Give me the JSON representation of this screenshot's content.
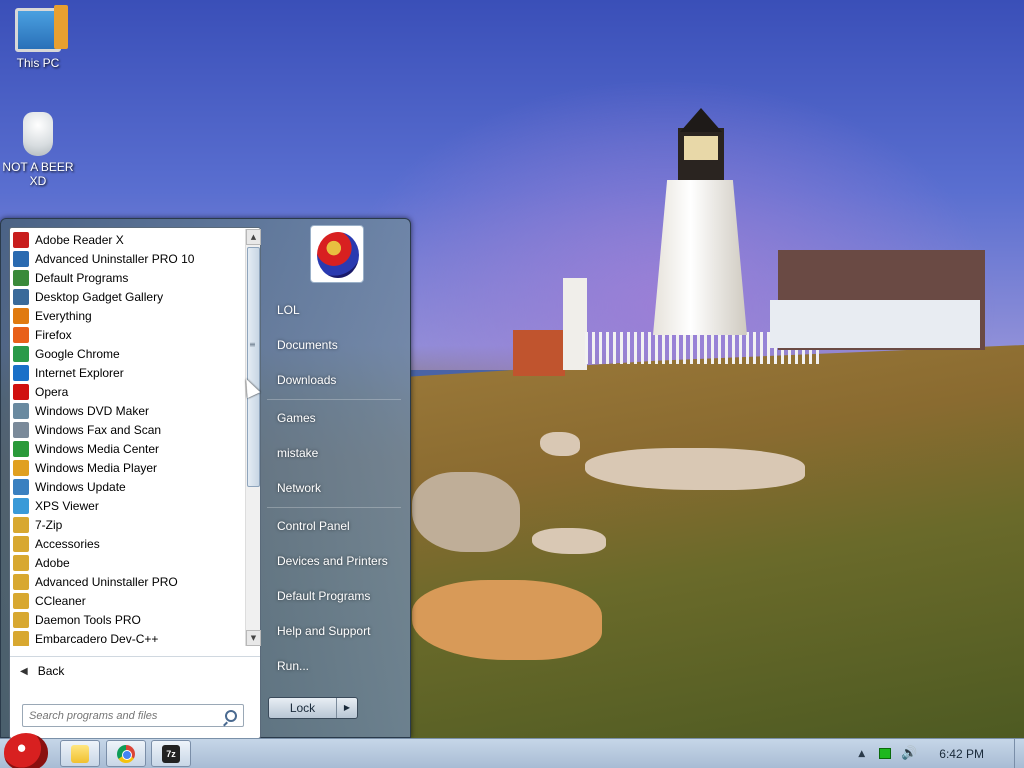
{
  "desktop": {
    "icons": [
      {
        "label": "This PC",
        "icon": "computer-icon"
      },
      {
        "label": "NOT A BEER XD",
        "icon": "jar-icon"
      }
    ]
  },
  "start_menu": {
    "programs": [
      {
        "label": "Adobe Reader X",
        "icon": "adobe-reader-icon",
        "color": "#c81e1e"
      },
      {
        "label": "Advanced Uninstaller PRO 10",
        "icon": "uninstaller-icon",
        "color": "#2a6ab0"
      },
      {
        "label": "Default Programs",
        "icon": "default-programs-icon",
        "color": "#3a8a3a"
      },
      {
        "label": "Desktop Gadget Gallery",
        "icon": "gadget-icon",
        "color": "#3a6a9a"
      },
      {
        "label": "Everything",
        "icon": "everything-icon",
        "color": "#e07a10"
      },
      {
        "label": "Firefox",
        "icon": "firefox-icon",
        "color": "#e8601a"
      },
      {
        "label": "Google Chrome",
        "icon": "chrome-icon",
        "color": "#2a9a4a"
      },
      {
        "label": "Internet Explorer",
        "icon": "ie-icon",
        "color": "#1a70c8"
      },
      {
        "label": "Opera",
        "icon": "opera-icon",
        "color": "#d01010"
      },
      {
        "label": "Windows DVD Maker",
        "icon": "dvd-maker-icon",
        "color": "#6a8aa0"
      },
      {
        "label": "Windows Fax and Scan",
        "icon": "fax-icon",
        "color": "#7a8a9a"
      },
      {
        "label": "Windows Media Center",
        "icon": "media-center-icon",
        "color": "#2a9a3a"
      },
      {
        "label": "Windows Media Player",
        "icon": "media-player-icon",
        "color": "#e0a020"
      },
      {
        "label": "Windows Update",
        "icon": "windows-update-icon",
        "color": "#3a80c0"
      },
      {
        "label": "XPS Viewer",
        "icon": "xps-viewer-icon",
        "color": "#3a9ad8"
      },
      {
        "label": "7-Zip",
        "icon": "folder-icon",
        "color": "#d8a830"
      },
      {
        "label": "Accessories",
        "icon": "folder-icon",
        "color": "#d8a830"
      },
      {
        "label": "Adobe",
        "icon": "folder-icon",
        "color": "#d8a830"
      },
      {
        "label": "Advanced Uninstaller PRO",
        "icon": "folder-icon",
        "color": "#d8a830"
      },
      {
        "label": "CCleaner",
        "icon": "folder-icon",
        "color": "#d8a830"
      },
      {
        "label": "Daemon Tools PRO",
        "icon": "folder-icon",
        "color": "#d8a830"
      },
      {
        "label": "Embarcadero Dev-C++",
        "icon": "folder-icon",
        "color": "#d8a830"
      }
    ],
    "back_label": "Back",
    "search_placeholder": "Search programs and files",
    "right_items": {
      "lol": "LOL",
      "documents": "Documents",
      "downloads": "Downloads",
      "games": "Games",
      "mistake": "mistake",
      "network": "Network",
      "control_panel": "Control Panel",
      "devices": "Devices and Printers",
      "default_programs": "Default Programs",
      "help": "Help and Support",
      "run": "Run..."
    },
    "lock_label": "Lock"
  },
  "taskbar": {
    "pinned": [
      {
        "name": "explorer",
        "icon": "folder-icon"
      },
      {
        "name": "chrome",
        "icon": "chrome-icon"
      },
      {
        "name": "7zip",
        "icon": "7zip-icon",
        "text": "7z"
      }
    ],
    "clock": "6:42 PM"
  }
}
